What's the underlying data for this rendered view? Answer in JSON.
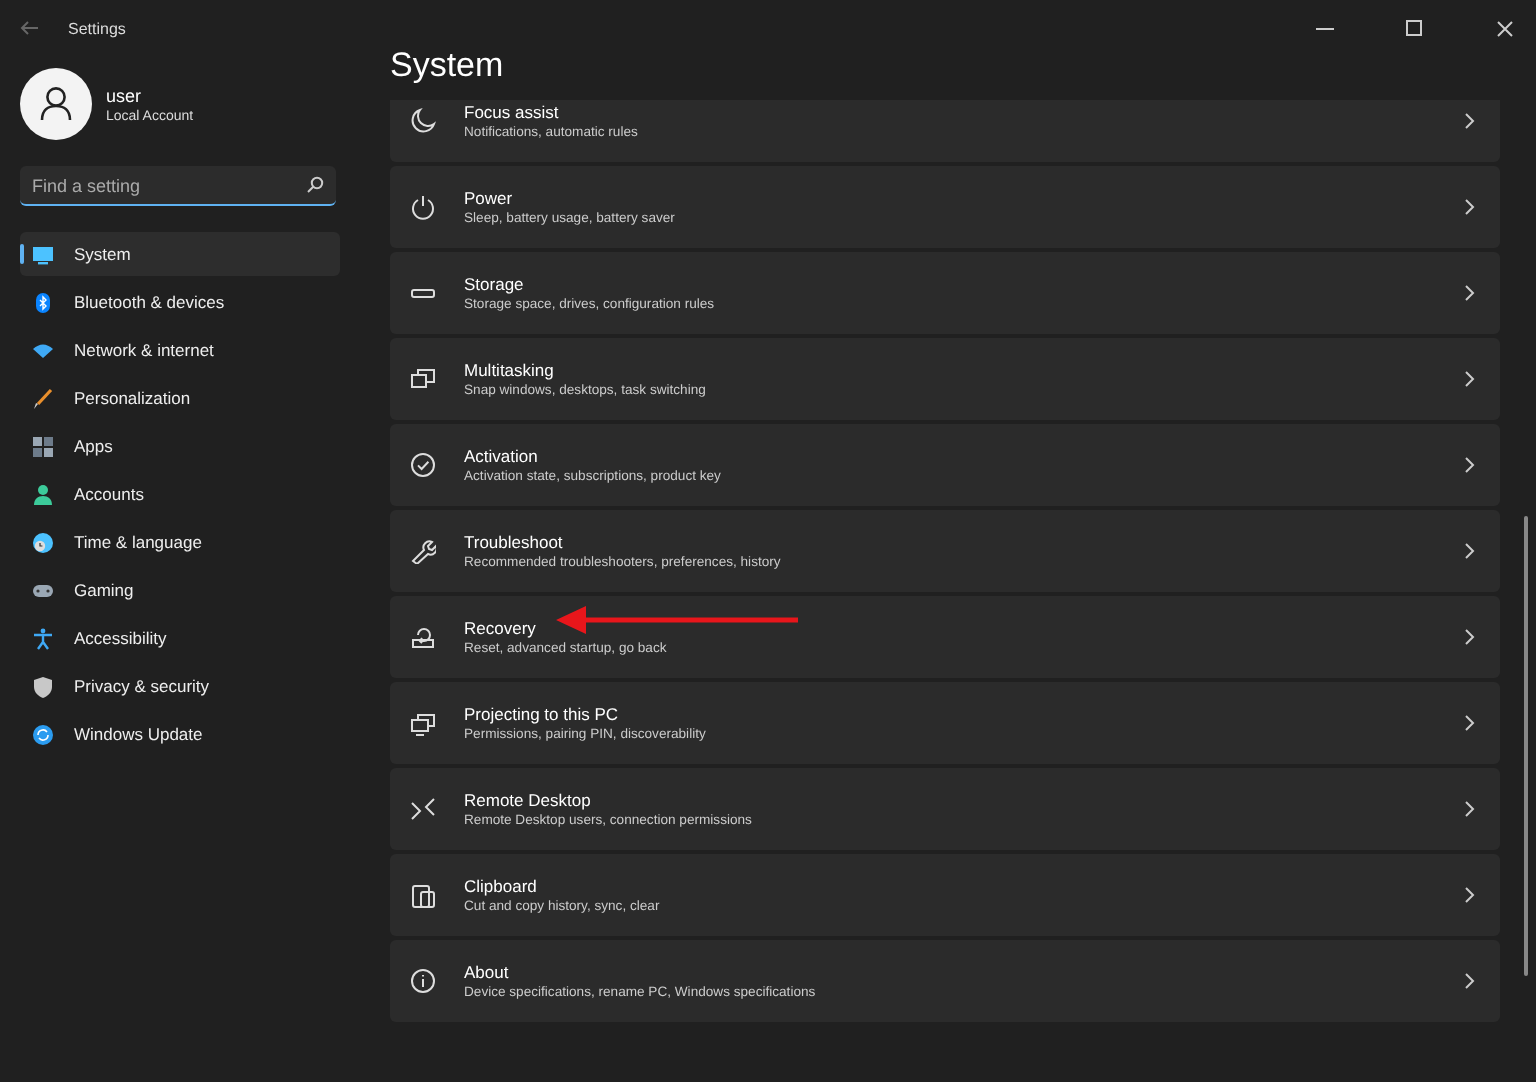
{
  "window": {
    "title": "Settings"
  },
  "account": {
    "name": "user",
    "type": "Local Account"
  },
  "search": {
    "placeholder": "Find a setting"
  },
  "sidebar": {
    "items": [
      {
        "label": "System",
        "selected": true
      },
      {
        "label": "Bluetooth & devices",
        "selected": false
      },
      {
        "label": "Network & internet",
        "selected": false
      },
      {
        "label": "Personalization",
        "selected": false
      },
      {
        "label": "Apps",
        "selected": false
      },
      {
        "label": "Accounts",
        "selected": false
      },
      {
        "label": "Time & language",
        "selected": false
      },
      {
        "label": "Gaming",
        "selected": false
      },
      {
        "label": "Accessibility",
        "selected": false
      },
      {
        "label": "Privacy & security",
        "selected": false
      },
      {
        "label": "Windows Update",
        "selected": false
      }
    ]
  },
  "page": {
    "title": "System",
    "items": [
      {
        "title": "Focus assist",
        "description": "Notifications, automatic rules"
      },
      {
        "title": "Power",
        "description": "Sleep, battery usage, battery saver"
      },
      {
        "title": "Storage",
        "description": "Storage space, drives, configuration rules"
      },
      {
        "title": "Multitasking",
        "description": "Snap windows, desktops, task switching"
      },
      {
        "title": "Activation",
        "description": "Activation state, subscriptions, product key"
      },
      {
        "title": "Troubleshoot",
        "description": "Recommended troubleshooters, preferences, history"
      },
      {
        "title": "Recovery",
        "description": "Reset, advanced startup, go back",
        "annotated": true
      },
      {
        "title": "Projecting to this PC",
        "description": "Permissions, pairing PIN, discoverability"
      },
      {
        "title": "Remote Desktop",
        "description": "Remote Desktop users, connection permissions"
      },
      {
        "title": "Clipboard",
        "description": "Cut and copy history, sync, clear"
      },
      {
        "title": "About",
        "description": "Device specifications, rename PC, Windows specifications"
      }
    ]
  }
}
